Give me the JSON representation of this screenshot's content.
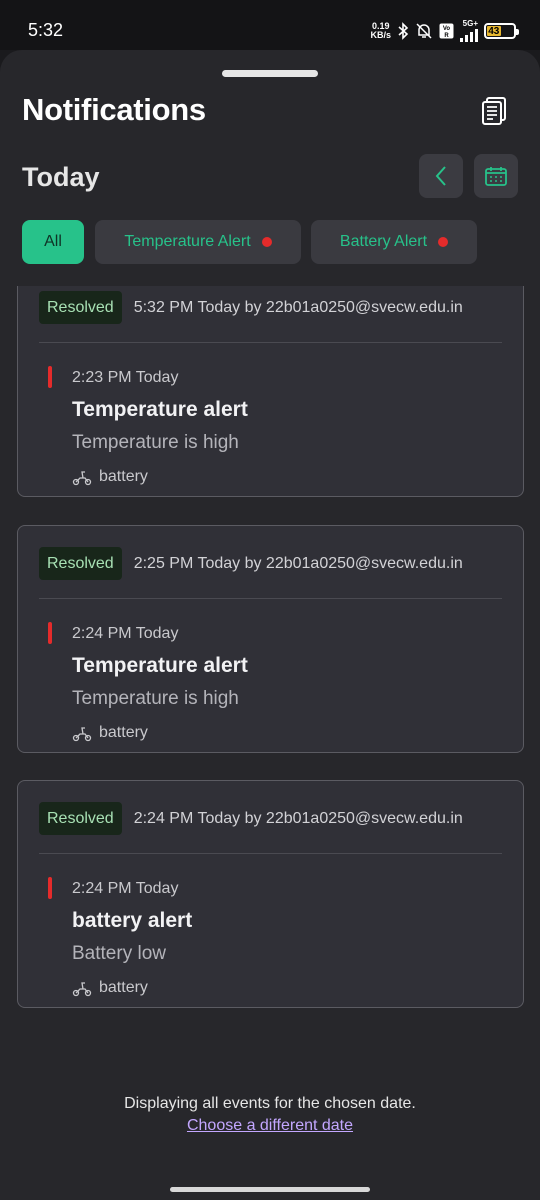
{
  "status_bar": {
    "time": "5:32",
    "net_speed_value": "0.19",
    "net_speed_unit": "KB/s",
    "network_type": "5G+",
    "battery_level": "43",
    "icons": [
      "bluetooth-icon",
      "muted-bell-icon",
      "volte-icon",
      "signal-icon",
      "battery-icon"
    ]
  },
  "header": {
    "title": "Notifications",
    "doc_icon": "documents-icon"
  },
  "date_bar": {
    "label": "Today",
    "back_icon": "chevron-left-icon",
    "calendar_icon": "calendar-icon"
  },
  "filters": [
    {
      "label": "All",
      "active": true,
      "has_dot": false
    },
    {
      "label": "Temperature Alert",
      "active": false,
      "has_dot": true
    },
    {
      "label": "Battery Alert",
      "active": false,
      "has_dot": true
    }
  ],
  "notifications": [
    {
      "status": "Resolved",
      "resolved_meta": "5:32 PM Today by 22b01a0250@svecw.edu.in",
      "time": "2:23 PM Today",
      "title": "Temperature alert",
      "message": "Temperature is high",
      "source": "battery",
      "source_icon": "scooter-icon"
    },
    {
      "status": "Resolved",
      "resolved_meta": "2:25 PM Today by 22b01a0250@svecw.edu.in",
      "time": "2:24 PM Today",
      "title": "Temperature alert",
      "message": "Temperature is high",
      "source": "battery",
      "source_icon": "scooter-icon"
    },
    {
      "status": "Resolved",
      "resolved_meta": "2:24 PM Today by 22b01a0250@svecw.edu.in",
      "time": "2:24 PM Today",
      "title": "battery alert",
      "message": "Battery low",
      "source": "battery",
      "source_icon": "scooter-icon"
    }
  ],
  "footer": {
    "info": "Displaying all events for the chosen date.",
    "link": "Choose a different date"
  },
  "colors": {
    "accent": "#27c28a",
    "alert": "#e52b2b",
    "link": "#c3a7ff",
    "sheet_bg": "#27272b",
    "card_bg": "#303037"
  }
}
